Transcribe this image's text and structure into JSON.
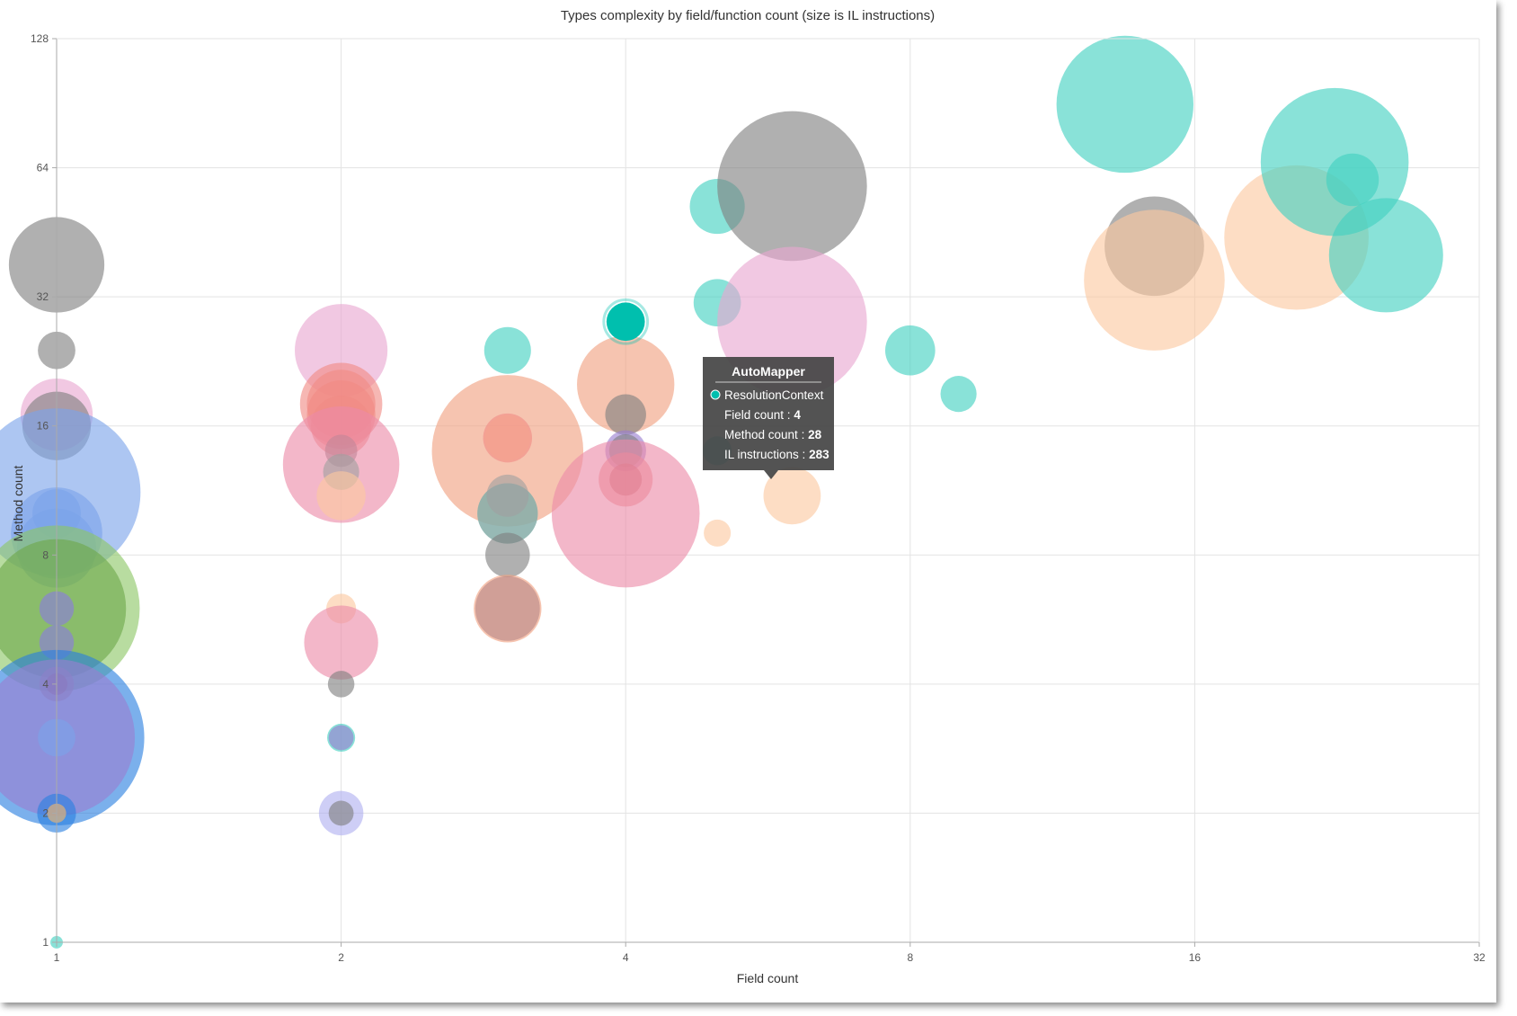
{
  "chart_data": {
    "type": "scatter",
    "subtype": "bubble",
    "title": "Types complexity by field/function count (size is IL instructions)",
    "xlabel": "Field count",
    "ylabel": "Method count",
    "x_scale": "log2",
    "y_scale": "log2",
    "xlim": [
      1,
      32
    ],
    "ylim": [
      1,
      128
    ],
    "x_ticks": [
      "1",
      "2",
      "4",
      "8",
      "16",
      "32"
    ],
    "y_ticks": [
      "1",
      "2",
      "4",
      "8",
      "16",
      "32",
      "64",
      "128"
    ],
    "grid": true,
    "legend": "none",
    "points": [
      {
        "x": 1,
        "y": 38,
        "size": 1750,
        "color": "#808080"
      },
      {
        "x": 1,
        "y": 24,
        "size": 270,
        "color": "#808080"
      },
      {
        "x": 1,
        "y": 17,
        "size": 1000,
        "color": "#e8a6d0"
      },
      {
        "x": 1,
        "y": 16,
        "size": 900,
        "color": "#808080"
      },
      {
        "x": 1,
        "y": 11.2,
        "size": 5400,
        "color": "#7ba3ea"
      },
      {
        "x": 1,
        "y": 10,
        "size": 450,
        "color": "#7ba3ea"
      },
      {
        "x": 1,
        "y": 9,
        "size": 1600,
        "color": "#7ba3ea"
      },
      {
        "x": 1,
        "y": 8.3,
        "size": 1200,
        "color": "#7ba3ea"
      },
      {
        "x": 1,
        "y": 6,
        "size": 5300,
        "color": "#8cc665"
      },
      {
        "x": 1,
        "y": 6,
        "size": 3700,
        "color": "#6ea84a"
      },
      {
        "x": 1,
        "y": 6,
        "size": 230,
        "color": "#8a7de0"
      },
      {
        "x": 1,
        "y": 5,
        "size": 230,
        "color": "#8a7de0"
      },
      {
        "x": 1,
        "y": 4,
        "size": 230,
        "color": "#f09080"
      },
      {
        "x": 1,
        "y": 4,
        "size": 90,
        "color": "#e05a3c"
      },
      {
        "x": 1,
        "y": 3,
        "size": 5900,
        "color": "#2a7fe0"
      },
      {
        "x": 1,
        "y": 3,
        "size": 4700,
        "color": "#9a7ed0"
      },
      {
        "x": 1,
        "y": 3,
        "size": 270,
        "color": "#7ba3ea"
      },
      {
        "x": 1,
        "y": 2,
        "size": 290,
        "color": "#2a7fe0"
      },
      {
        "x": 1,
        "y": 2,
        "size": 70,
        "color": "#f4b76b"
      },
      {
        "x": 1,
        "y": 1,
        "size": 30,
        "color": "#40d0c0"
      },
      {
        "x": 2,
        "y": 24,
        "size": 1650,
        "color": "#e8a6d0"
      },
      {
        "x": 2,
        "y": 18,
        "size": 1300,
        "color": "#f08a84"
      },
      {
        "x": 2,
        "y": 18,
        "size": 900,
        "color": "#f08a84"
      },
      {
        "x": 2,
        "y": 17,
        "size": 900,
        "color": "#f08a84"
      },
      {
        "x": 2,
        "y": 16,
        "size": 700,
        "color": "#f08a84"
      },
      {
        "x": 2,
        "y": 14,
        "size": 200,
        "color": "#808080"
      },
      {
        "x": 2,
        "y": 13,
        "size": 2600,
        "color": "#ec8aa8"
      },
      {
        "x": 2,
        "y": 12.5,
        "size": 250,
        "color": "#a0a0a0"
      },
      {
        "x": 2,
        "y": 11,
        "size": 460,
        "color": "#fbc8a0"
      },
      {
        "x": 2,
        "y": 6,
        "size": 170,
        "color": "#fbc8a0"
      },
      {
        "x": 2,
        "y": 5,
        "size": 1050,
        "color": "#ec8aa8"
      },
      {
        "x": 2,
        "y": 4,
        "size": 135,
        "color": "#808080"
      },
      {
        "x": 2,
        "y": 3,
        "size": 150,
        "color": "#40d0c0"
      },
      {
        "x": 2,
        "y": 3,
        "size": 120,
        "color": "#9a7ed0"
      },
      {
        "x": 2,
        "y": 2,
        "size": 380,
        "color": "#b0b0f0"
      },
      {
        "x": 2,
        "y": 2,
        "size": 120,
        "color": "#808080"
      },
      {
        "x": 3,
        "y": 24,
        "size": 420,
        "color": "#40d0c0"
      },
      {
        "x": 3,
        "y": 14,
        "size": 4400,
        "color": "#f0a080"
      },
      {
        "x": 3,
        "y": 15,
        "size": 400,
        "color": "#fbc8a0"
      },
      {
        "x": 3,
        "y": 15,
        "size": 460,
        "color": "#f08a84"
      },
      {
        "x": 3,
        "y": 10,
        "size": 700,
        "color": "#40d0c0"
      },
      {
        "x": 3,
        "y": 11,
        "size": 340,
        "color": "#a0a0a0"
      },
      {
        "x": 3,
        "y": 10,
        "size": 700,
        "color": "#a0a0a0"
      },
      {
        "x": 3,
        "y": 8,
        "size": 380,
        "color": "#808080"
      },
      {
        "x": 3,
        "y": 6,
        "size": 880,
        "color": "#f0a080"
      },
      {
        "x": 3,
        "y": 6,
        "size": 800,
        "color": "#b88888"
      },
      {
        "x": 4,
        "y": 20,
        "size": 1820,
        "color": "#f0a080"
      },
      {
        "x": 4,
        "y": 28,
        "size": 283,
        "color": "#00bfae",
        "highlight": true
      },
      {
        "x": 4,
        "y": 17,
        "size": 320,
        "color": "#808080"
      },
      {
        "x": 4,
        "y": 14,
        "size": 320,
        "color": "#9a7ed0"
      },
      {
        "x": 4,
        "y": 14,
        "size": 210,
        "color": "#808080"
      },
      {
        "x": 4,
        "y": 12,
        "size": 560,
        "color": "#ec8a8a"
      },
      {
        "x": 4,
        "y": 12,
        "size": 200,
        "color": "#d07070"
      },
      {
        "x": 4,
        "y": 10,
        "size": 4200,
        "color": "#ec8aa8"
      },
      {
        "x": 5,
        "y": 52,
        "size": 580,
        "color": "#40d0c0"
      },
      {
        "x": 5,
        "y": 31,
        "size": 430,
        "color": "#40d0c0"
      },
      {
        "x": 5,
        "y": 14,
        "size": 160,
        "color": "#40d0c0"
      },
      {
        "x": 5,
        "y": 9,
        "size": 140,
        "color": "#fbc8a0"
      },
      {
        "x": 6,
        "y": 58,
        "size": 4300,
        "color": "#808080"
      },
      {
        "x": 6,
        "y": 28,
        "size": 4300,
        "color": "#e8a6d0"
      },
      {
        "x": 6,
        "y": 11,
        "size": 630,
        "color": "#fbc8a0"
      },
      {
        "x": 8,
        "y": 24,
        "size": 480,
        "color": "#40d0c0"
      },
      {
        "x": 9,
        "y": 19,
        "size": 250,
        "color": "#40d0c0"
      },
      {
        "x": 13.5,
        "y": 90,
        "size": 3600,
        "color": "#40d0c0"
      },
      {
        "x": 14.5,
        "y": 42,
        "size": 1900,
        "color": "#808080"
      },
      {
        "x": 14.5,
        "y": 35,
        "size": 3800,
        "color": "#fbc8a0"
      },
      {
        "x": 20.5,
        "y": 44,
        "size": 4000,
        "color": "#fbc8a0"
      },
      {
        "x": 22.5,
        "y": 66,
        "size": 4200,
        "color": "#40d0c0"
      },
      {
        "x": 23.5,
        "y": 60,
        "size": 530,
        "color": "#40d0c0"
      },
      {
        "x": 25.5,
        "y": 40,
        "size": 2500,
        "color": "#40d0c0"
      }
    ],
    "tooltip": {
      "title": "AutoMapper",
      "series_name": "ResolutionContext",
      "series_color": "#00bfae",
      "rows": [
        {
          "label": "Field count",
          "value": "4"
        },
        {
          "label": "Method count",
          "value": "28"
        },
        {
          "label": "IL instructions",
          "value": "283"
        }
      ]
    }
  }
}
